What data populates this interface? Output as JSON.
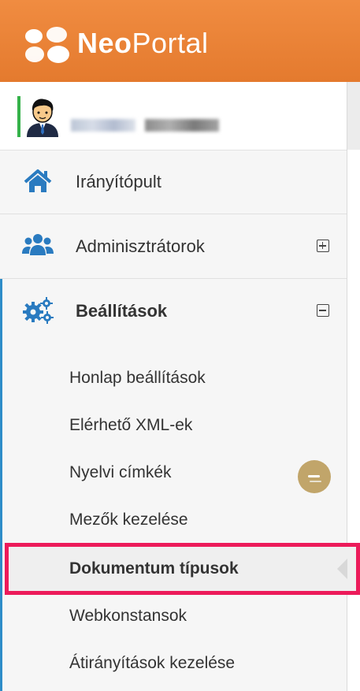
{
  "brand": {
    "bold": "Neo",
    "regular": "Portal"
  },
  "colors": {
    "header": "#e88437",
    "accent": "#2e8cc8",
    "highlight": "#ec1b5a",
    "icon_blue": "#2a7bc0",
    "badge": "#c1a56a"
  },
  "user": {
    "avatar_icon": "user-avatar-icon",
    "name_blurred": true
  },
  "menu": [
    {
      "label": "Irányítópult",
      "icon": "home-icon",
      "expandable": false
    },
    {
      "label": "Adminisztrátorok",
      "icon": "users-icon",
      "expandable": true,
      "expanded": false
    },
    {
      "label": "Beállítások",
      "icon": "cogs-icon",
      "expandable": true,
      "expanded": true
    }
  ],
  "submenu": [
    {
      "label": "Honlap beállítások"
    },
    {
      "label": "Elérhető XML-ek"
    },
    {
      "label": "Nyelvi címkék",
      "badge_icon": "badge-icon"
    },
    {
      "label": "Mezők kezelése"
    },
    {
      "label": "Dokumentum típusok",
      "active": true
    },
    {
      "label": "Webkonstansok"
    },
    {
      "label": "Átirányítások kezelése"
    }
  ]
}
